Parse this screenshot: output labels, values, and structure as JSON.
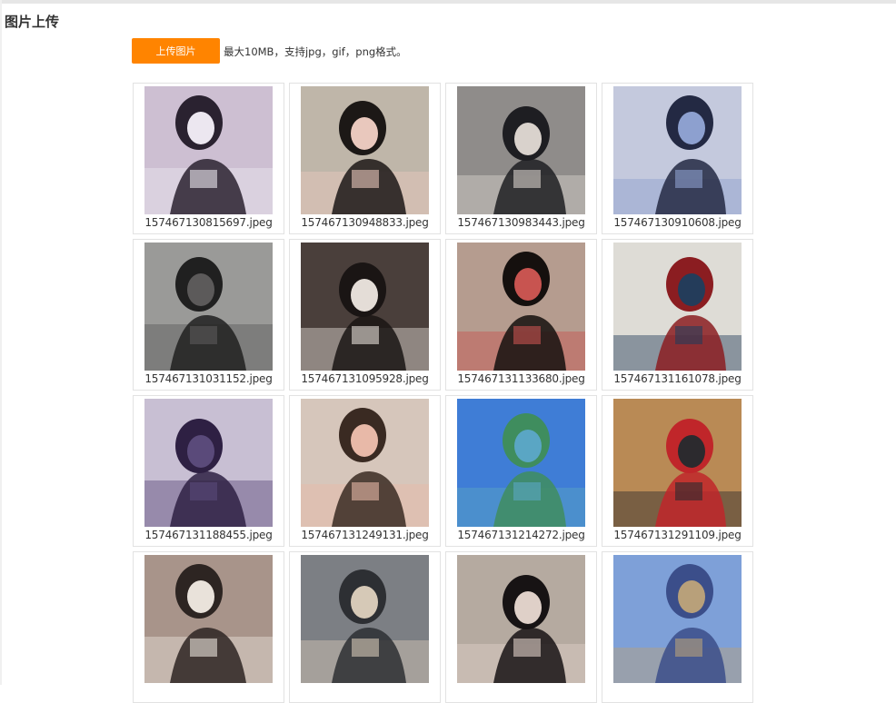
{
  "page": {
    "title": "图片上传"
  },
  "upload": {
    "button_label": "上传图片",
    "hint": "最大10MB，支持jpg，gif，png格式。"
  },
  "colors": {
    "accent": "#ff8400"
  },
  "images": [
    {
      "filename": "157467130815697.jpeg",
      "palette": [
        "#cdbfd2",
        "#2a2230",
        "#ece7f0"
      ]
    },
    {
      "filename": "157467130948833.jpeg",
      "palette": [
        "#bfb6a9",
        "#1c1816",
        "#e9c8bd"
      ]
    },
    {
      "filename": "157467130983443.jpeg",
      "palette": [
        "#8f8c8a",
        "#1e1e22",
        "#d9d2cc"
      ]
    },
    {
      "filename": "157467130910608.jpeg",
      "palette": [
        "#c4c9dd",
        "#232943",
        "#8da0cf"
      ]
    },
    {
      "filename": "157467131031152.jpeg",
      "palette": [
        "#9a9a98",
        "#202020",
        "#5c5a5a"
      ]
    },
    {
      "filename": "157467131095928.jpeg",
      "palette": [
        "#4a3f3b",
        "#1a1514",
        "#e4ddd7"
      ]
    },
    {
      "filename": "157467131133680.jpeg",
      "palette": [
        "#b59c8f",
        "#15100e",
        "#c85450"
      ]
    },
    {
      "filename": "157467131161078.jpeg",
      "palette": [
        "#dedcd6",
        "#8b1d21",
        "#243c5a"
      ]
    },
    {
      "filename": "157467131188455.jpeg",
      "palette": [
        "#c8bfd3",
        "#2e2043",
        "#5a4a7a"
      ]
    },
    {
      "filename": "157467131249131.jpeg",
      "palette": [
        "#d6c6bb",
        "#3a2a22",
        "#e8b9a8"
      ]
    },
    {
      "filename": "157467131214272.jpeg",
      "palette": [
        "#3f7dd6",
        "#3f8d5e",
        "#5aa6c4"
      ]
    },
    {
      "filename": "157467131291109.jpeg",
      "palette": [
        "#b98a55",
        "#c0262a",
        "#2c2a2e"
      ]
    },
    {
      "filename": "",
      "palette": [
        "#a8948a",
        "#2d2522",
        "#e9e2da"
      ]
    },
    {
      "filename": "",
      "palette": [
        "#7c7f84",
        "#2d2f33",
        "#d6c9b7"
      ]
    },
    {
      "filename": "",
      "palette": [
        "#b5aaa0",
        "#171314",
        "#dfd0c8"
      ]
    },
    {
      "filename": "",
      "palette": [
        "#7ea0d8",
        "#3b4e8a",
        "#b8a07a"
      ]
    }
  ]
}
